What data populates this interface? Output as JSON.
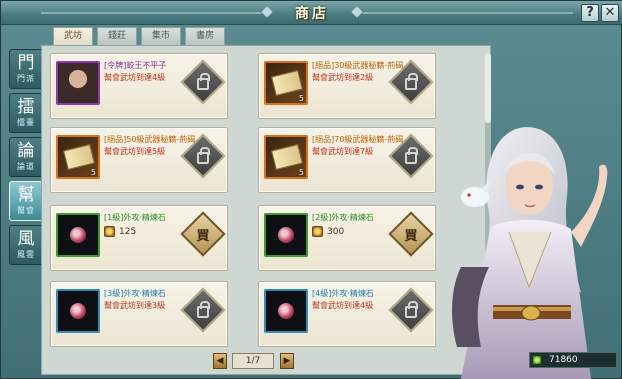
{
  "window": {
    "title": "商店",
    "help_label": "?",
    "close_label": "✕"
  },
  "tabs": [
    {
      "label": "武坊",
      "active": true
    },
    {
      "label": "錢莊",
      "active": false
    },
    {
      "label": "集市",
      "active": false
    },
    {
      "label": "書房",
      "active": false
    }
  ],
  "sidebar": {
    "items": [
      {
        "glyph": "門",
        "label": "門派",
        "active": false
      },
      {
        "glyph": "擂",
        "label": "擂臺",
        "active": false
      },
      {
        "glyph": "論",
        "label": "論道",
        "active": false
      },
      {
        "glyph": "幫",
        "label": "幫會",
        "active": true
      },
      {
        "glyph": "風",
        "label": "風雲",
        "active": false
      }
    ]
  },
  "items": [
    {
      "name": "[令牌]蛟王不平子",
      "requirement": "幫會武坊到達4級",
      "price": "",
      "action": "locked",
      "action_label": "",
      "quantity": "",
      "icon": "portrait-icon",
      "quality": "purple"
    },
    {
      "name": "[絕品]30級武器秘籍-荊碣",
      "requirement": "幫會武坊到達2級",
      "price": "",
      "action": "locked",
      "action_label": "",
      "quantity": "5",
      "icon": "book-icon",
      "quality": "orange"
    },
    {
      "name": "[絕品]50級武器秘籍-荊碣",
      "requirement": "幫會武坊到達5級",
      "price": "",
      "action": "locked",
      "action_label": "",
      "quantity": "5",
      "icon": "book-icon",
      "quality": "orange"
    },
    {
      "name": "[絕品]70級武器秘籍-荊碣",
      "requirement": "幫會武坊到達7級",
      "price": "",
      "action": "locked",
      "action_label": "",
      "quantity": "5",
      "icon": "book-icon",
      "quality": "orange"
    },
    {
      "name": "[1級]外攻·精煉石",
      "requirement": "",
      "price": "125",
      "action": "buy",
      "action_label": "買",
      "quantity": "",
      "icon": "stone-icon",
      "quality": "green"
    },
    {
      "name": "[2級]外攻·精煉石",
      "requirement": "",
      "price": "300",
      "action": "buy",
      "action_label": "買",
      "quantity": "",
      "icon": "stone-icon",
      "quality": "green"
    },
    {
      "name": "[3級]外攻·精煉石",
      "requirement": "幫會武坊到達3級",
      "price": "",
      "action": "locked",
      "action_label": "",
      "quantity": "",
      "icon": "stone-icon",
      "quality": "blue"
    },
    {
      "name": "[4級]外攻·精煉石",
      "requirement": "幫會武坊到達4級",
      "price": "",
      "action": "locked",
      "action_label": "",
      "quantity": "",
      "icon": "stone-icon",
      "quality": "blue"
    }
  ],
  "pagination": {
    "label": "1/7",
    "prev_label": "◀",
    "next_label": "▶"
  },
  "currency": {
    "value": "71860",
    "icon": "coin-icon"
  },
  "colors": {
    "frame": "#4b7c82",
    "panel": "#cfd7d2",
    "card": "#f7f3e8",
    "requirement": "#c23019"
  }
}
